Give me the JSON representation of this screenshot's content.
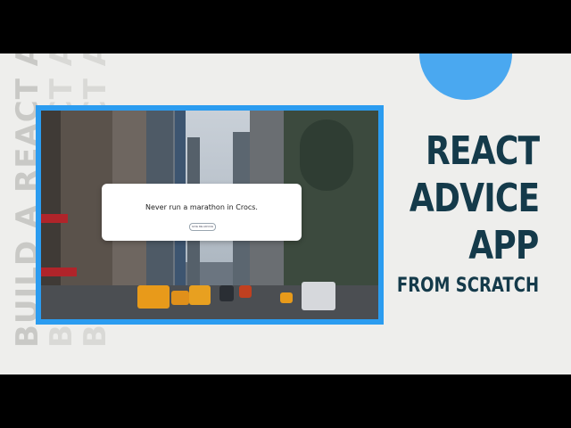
{
  "thumbnail": {
    "vertical_text": "BUILD A REACT APP",
    "title_lines": [
      "REACT",
      "ADVICE",
      "APP"
    ],
    "subtitle": "FROM SCRATCH",
    "preview": {
      "advice_text": "Never run a marathon in Crocs.",
      "button_label": "GIVE ME ADVICE"
    }
  },
  "colors": {
    "accent_blue": "#2b9cf0",
    "title_dark": "#143a4a",
    "background": "#eeeeec"
  }
}
